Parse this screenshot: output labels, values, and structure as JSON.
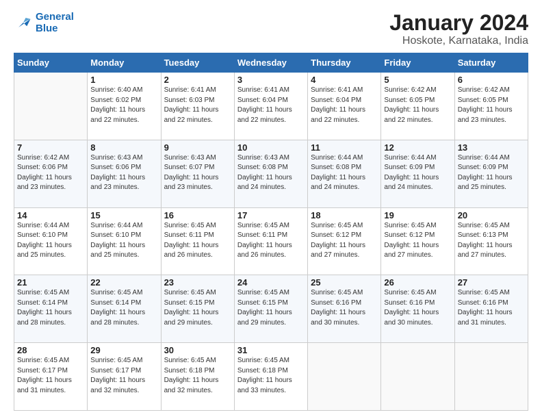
{
  "logo": {
    "line1": "General",
    "line2": "Blue"
  },
  "title": "January 2024",
  "subtitle": "Hoskote, Karnataka, India",
  "weekdays": [
    "Sunday",
    "Monday",
    "Tuesday",
    "Wednesday",
    "Thursday",
    "Friday",
    "Saturday"
  ],
  "rows": [
    [
      {
        "day": "",
        "sunrise": "",
        "sunset": "",
        "daylight": "",
        "empty": true
      },
      {
        "day": "1",
        "sunrise": "Sunrise: 6:40 AM",
        "sunset": "Sunset: 6:02 PM",
        "daylight": "Daylight: 11 hours and 22 minutes."
      },
      {
        "day": "2",
        "sunrise": "Sunrise: 6:41 AM",
        "sunset": "Sunset: 6:03 PM",
        "daylight": "Daylight: 11 hours and 22 minutes."
      },
      {
        "day": "3",
        "sunrise": "Sunrise: 6:41 AM",
        "sunset": "Sunset: 6:04 PM",
        "daylight": "Daylight: 11 hours and 22 minutes."
      },
      {
        "day": "4",
        "sunrise": "Sunrise: 6:41 AM",
        "sunset": "Sunset: 6:04 PM",
        "daylight": "Daylight: 11 hours and 22 minutes."
      },
      {
        "day": "5",
        "sunrise": "Sunrise: 6:42 AM",
        "sunset": "Sunset: 6:05 PM",
        "daylight": "Daylight: 11 hours and 22 minutes."
      },
      {
        "day": "6",
        "sunrise": "Sunrise: 6:42 AM",
        "sunset": "Sunset: 6:05 PM",
        "daylight": "Daylight: 11 hours and 23 minutes."
      }
    ],
    [
      {
        "day": "7",
        "sunrise": "Sunrise: 6:42 AM",
        "sunset": "Sunset: 6:06 PM",
        "daylight": "Daylight: 11 hours and 23 minutes."
      },
      {
        "day": "8",
        "sunrise": "Sunrise: 6:43 AM",
        "sunset": "Sunset: 6:06 PM",
        "daylight": "Daylight: 11 hours and 23 minutes."
      },
      {
        "day": "9",
        "sunrise": "Sunrise: 6:43 AM",
        "sunset": "Sunset: 6:07 PM",
        "daylight": "Daylight: 11 hours and 23 minutes."
      },
      {
        "day": "10",
        "sunrise": "Sunrise: 6:43 AM",
        "sunset": "Sunset: 6:08 PM",
        "daylight": "Daylight: 11 hours and 24 minutes."
      },
      {
        "day": "11",
        "sunrise": "Sunrise: 6:44 AM",
        "sunset": "Sunset: 6:08 PM",
        "daylight": "Daylight: 11 hours and 24 minutes."
      },
      {
        "day": "12",
        "sunrise": "Sunrise: 6:44 AM",
        "sunset": "Sunset: 6:09 PM",
        "daylight": "Daylight: 11 hours and 24 minutes."
      },
      {
        "day": "13",
        "sunrise": "Sunrise: 6:44 AM",
        "sunset": "Sunset: 6:09 PM",
        "daylight": "Daylight: 11 hours and 25 minutes."
      }
    ],
    [
      {
        "day": "14",
        "sunrise": "Sunrise: 6:44 AM",
        "sunset": "Sunset: 6:10 PM",
        "daylight": "Daylight: 11 hours and 25 minutes."
      },
      {
        "day": "15",
        "sunrise": "Sunrise: 6:44 AM",
        "sunset": "Sunset: 6:10 PM",
        "daylight": "Daylight: 11 hours and 25 minutes."
      },
      {
        "day": "16",
        "sunrise": "Sunrise: 6:45 AM",
        "sunset": "Sunset: 6:11 PM",
        "daylight": "Daylight: 11 hours and 26 minutes."
      },
      {
        "day": "17",
        "sunrise": "Sunrise: 6:45 AM",
        "sunset": "Sunset: 6:11 PM",
        "daylight": "Daylight: 11 hours and 26 minutes."
      },
      {
        "day": "18",
        "sunrise": "Sunrise: 6:45 AM",
        "sunset": "Sunset: 6:12 PM",
        "daylight": "Daylight: 11 hours and 27 minutes."
      },
      {
        "day": "19",
        "sunrise": "Sunrise: 6:45 AM",
        "sunset": "Sunset: 6:12 PM",
        "daylight": "Daylight: 11 hours and 27 minutes."
      },
      {
        "day": "20",
        "sunrise": "Sunrise: 6:45 AM",
        "sunset": "Sunset: 6:13 PM",
        "daylight": "Daylight: 11 hours and 27 minutes."
      }
    ],
    [
      {
        "day": "21",
        "sunrise": "Sunrise: 6:45 AM",
        "sunset": "Sunset: 6:14 PM",
        "daylight": "Daylight: 11 hours and 28 minutes."
      },
      {
        "day": "22",
        "sunrise": "Sunrise: 6:45 AM",
        "sunset": "Sunset: 6:14 PM",
        "daylight": "Daylight: 11 hours and 28 minutes."
      },
      {
        "day": "23",
        "sunrise": "Sunrise: 6:45 AM",
        "sunset": "Sunset: 6:15 PM",
        "daylight": "Daylight: 11 hours and 29 minutes."
      },
      {
        "day": "24",
        "sunrise": "Sunrise: 6:45 AM",
        "sunset": "Sunset: 6:15 PM",
        "daylight": "Daylight: 11 hours and 29 minutes."
      },
      {
        "day": "25",
        "sunrise": "Sunrise: 6:45 AM",
        "sunset": "Sunset: 6:16 PM",
        "daylight": "Daylight: 11 hours and 30 minutes."
      },
      {
        "day": "26",
        "sunrise": "Sunrise: 6:45 AM",
        "sunset": "Sunset: 6:16 PM",
        "daylight": "Daylight: 11 hours and 30 minutes."
      },
      {
        "day": "27",
        "sunrise": "Sunrise: 6:45 AM",
        "sunset": "Sunset: 6:16 PM",
        "daylight": "Daylight: 11 hours and 31 minutes."
      }
    ],
    [
      {
        "day": "28",
        "sunrise": "Sunrise: 6:45 AM",
        "sunset": "Sunset: 6:17 PM",
        "daylight": "Daylight: 11 hours and 31 minutes."
      },
      {
        "day": "29",
        "sunrise": "Sunrise: 6:45 AM",
        "sunset": "Sunset: 6:17 PM",
        "daylight": "Daylight: 11 hours and 32 minutes."
      },
      {
        "day": "30",
        "sunrise": "Sunrise: 6:45 AM",
        "sunset": "Sunset: 6:18 PM",
        "daylight": "Daylight: 11 hours and 32 minutes."
      },
      {
        "day": "31",
        "sunrise": "Sunrise: 6:45 AM",
        "sunset": "Sunset: 6:18 PM",
        "daylight": "Daylight: 11 hours and 33 minutes."
      },
      {
        "day": "",
        "sunrise": "",
        "sunset": "",
        "daylight": "",
        "empty": true
      },
      {
        "day": "",
        "sunrise": "",
        "sunset": "",
        "daylight": "",
        "empty": true
      },
      {
        "day": "",
        "sunrise": "",
        "sunset": "",
        "daylight": "",
        "empty": true
      }
    ]
  ]
}
